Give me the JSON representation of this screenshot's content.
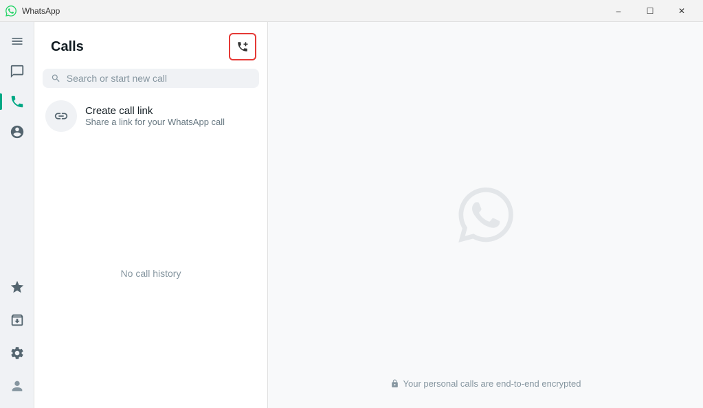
{
  "titlebar": {
    "app_name": "WhatsApp",
    "btn_minimize": "–",
    "btn_maximize": "☐",
    "btn_close": "✕"
  },
  "sidebar": {
    "items": [
      {
        "id": "menu",
        "label": "menu-icon",
        "icon": "menu"
      },
      {
        "id": "chat",
        "label": "chat-icon",
        "icon": "chat"
      },
      {
        "id": "calls",
        "label": "calls-icon",
        "icon": "calls",
        "active": true
      },
      {
        "id": "status",
        "label": "status-icon",
        "icon": "status"
      }
    ],
    "bottom": [
      {
        "id": "starred",
        "label": "starred-icon",
        "icon": "star"
      },
      {
        "id": "archived",
        "label": "archived-icon",
        "icon": "archive"
      },
      {
        "id": "settings",
        "label": "settings-icon",
        "icon": "settings"
      },
      {
        "id": "profile",
        "label": "profile-icon",
        "icon": "profile"
      }
    ]
  },
  "left_panel": {
    "title": "Calls",
    "new_call_btn_label": "new-call-button",
    "search_placeholder": "Search or start new call",
    "call_link": {
      "title": "Create call link",
      "subtitle": "Share a link for your WhatsApp call"
    },
    "no_history_text": "No call history"
  },
  "right_panel": {
    "encrypted_text": "Your personal calls are end-to-end encrypted"
  },
  "colors": {
    "accent": "#00a884",
    "highlight_border": "#e53935",
    "bg_right": "#f8f9fa",
    "bg_sidebar": "#f0f2f5"
  }
}
